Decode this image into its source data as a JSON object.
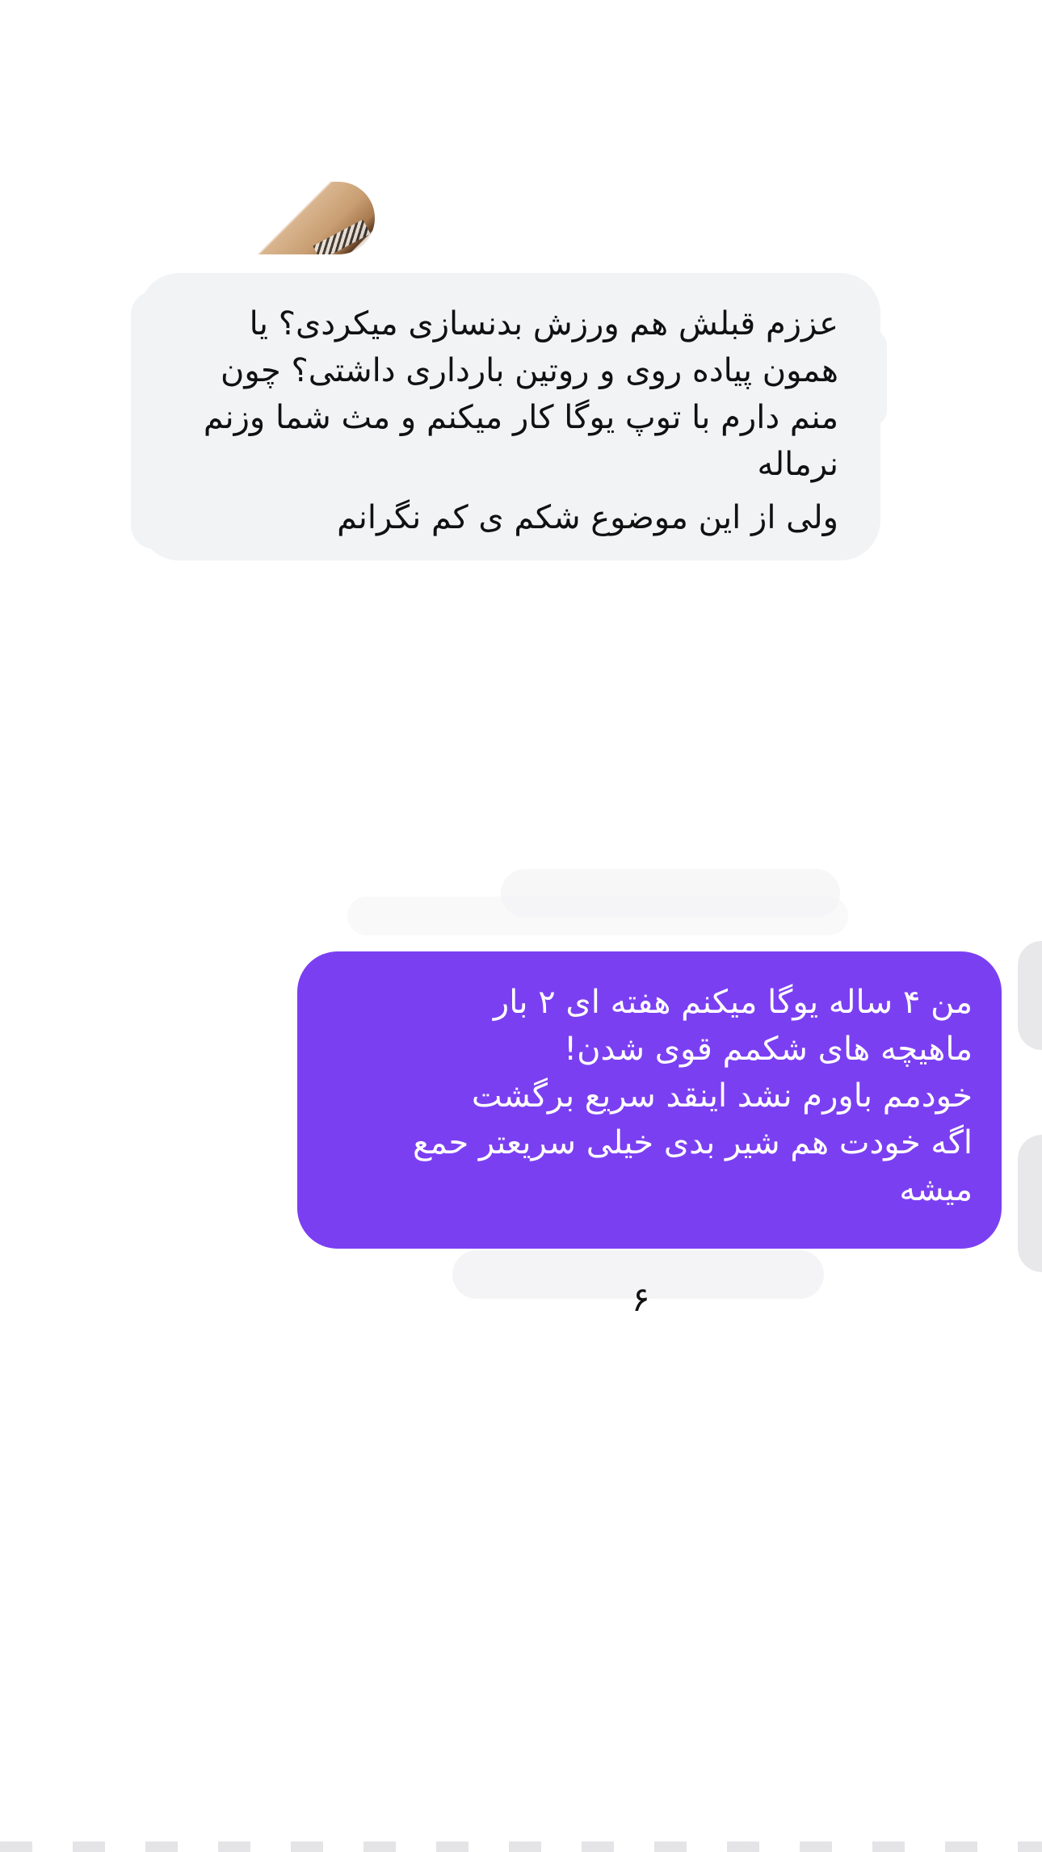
{
  "conversation": {
    "incoming_message": {
      "lines": [
        "عززم قبلش هم ورزش بدنسازی میکردی؟ یا",
        "همون پیاده روی و روتین بارداری داشتی؟ چون",
        "منم دارم با توپ یوگا کار میکنم و مث شما وزنم",
        "نرماله",
        "ولی از این موضوع شکم ی کم نگرانم"
      ]
    },
    "outgoing_message": {
      "lines": [
        "من ۴ ساله یوگا میکنم هفته ای ۲ بار",
        "ماهیچه های شکمم قوی شدن!",
        "خودمم باورم نشد اینقد سریع برگشت",
        "اگه خودت هم شیر بدی خیلی سریعتر حمع",
        "میشه"
      ]
    },
    "stray_glyph": "۶"
  },
  "colors": {
    "incoming_bubble": "#f2f3f5",
    "outgoing_bubble": "#7b3ff2",
    "incoming_text": "#111111",
    "outgoing_text": "#ffffff"
  }
}
